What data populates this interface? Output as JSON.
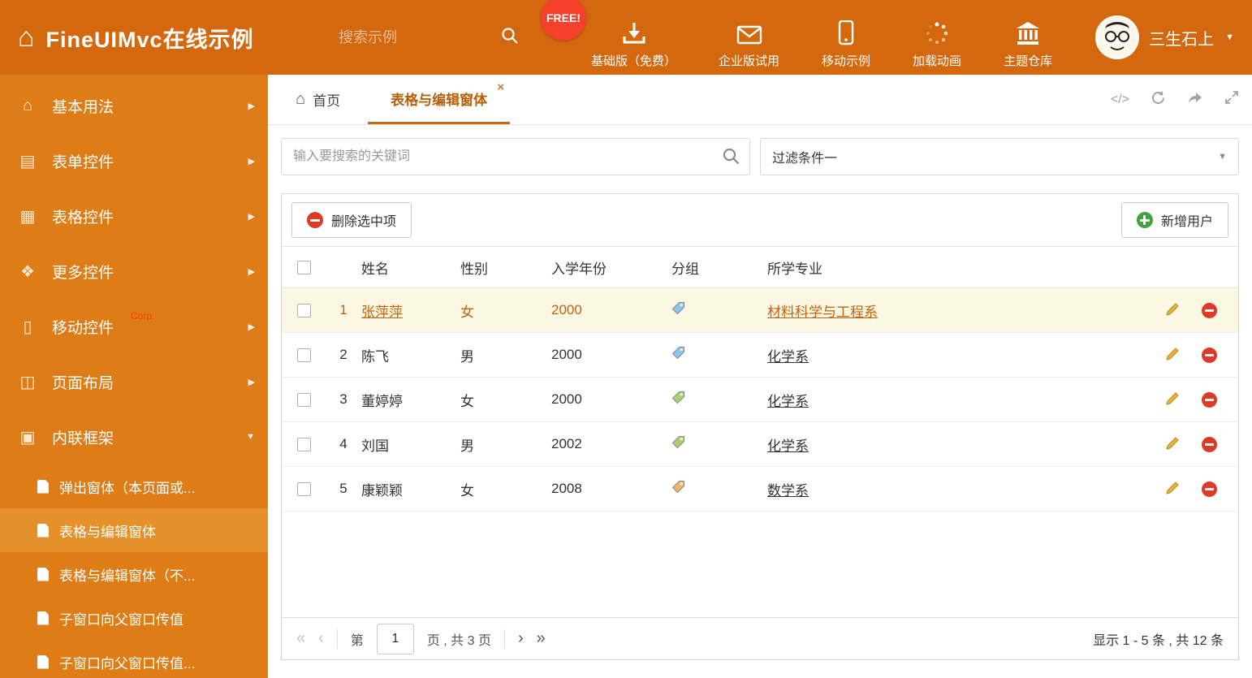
{
  "header": {
    "title": "FineUIMvc在线示例",
    "search_placeholder": "搜索示例",
    "free_badge": "FREE!",
    "nav_items": [
      {
        "label": "基础版（免费）",
        "icon": "download-icon"
      },
      {
        "label": "企业版试用",
        "icon": "mail-icon"
      },
      {
        "label": "移动示例",
        "icon": "mobile-icon"
      },
      {
        "label": "加载动画",
        "icon": "spinner-icon"
      },
      {
        "label": "主题仓库",
        "icon": "bank-icon"
      }
    ],
    "user_name": "三生石上"
  },
  "sidebar": {
    "items": [
      {
        "label": "基本用法"
      },
      {
        "label": "表单控件"
      },
      {
        "label": "表格控件"
      },
      {
        "label": "更多控件"
      },
      {
        "label": "移动控件",
        "badge": "Corp."
      },
      {
        "label": "页面布局"
      },
      {
        "label": "内联框架"
      }
    ],
    "subitems": [
      {
        "label": "弹出窗体（本页面或..."
      },
      {
        "label": "表格与编辑窗体"
      },
      {
        "label": "表格与编辑窗体（不..."
      },
      {
        "label": "子窗口向父窗口传值"
      },
      {
        "label": "子窗口向父窗口传值..."
      }
    ]
  },
  "tabs": {
    "home": "首页",
    "active": "表格与编辑窗体"
  },
  "filters": {
    "search_placeholder": "输入要搜索的关键词",
    "selected_filter": "过滤条件一"
  },
  "toolbar": {
    "delete_label": "删除选中项",
    "add_label": "新增用户"
  },
  "table": {
    "columns": {
      "name": "姓名",
      "gender": "性别",
      "year": "入学年份",
      "group": "分组",
      "major": "所学专业"
    },
    "rows": [
      {
        "num": "1",
        "name": "张萍萍",
        "gender": "女",
        "year": "2000",
        "tag_color": "#8ec6ea",
        "major": "材料科学与工程系",
        "highlighted": true
      },
      {
        "num": "2",
        "name": "陈飞",
        "gender": "男",
        "year": "2000",
        "tag_color": "#8ec6ea",
        "major": "化学系",
        "highlighted": false
      },
      {
        "num": "3",
        "name": "董婷婷",
        "gender": "女",
        "year": "2000",
        "tag_color": "#a8d36c",
        "major": "化学系",
        "highlighted": false
      },
      {
        "num": "4",
        "name": "刘国",
        "gender": "男",
        "year": "2002",
        "tag_color": "#a8d36c",
        "major": "化学系",
        "highlighted": false
      },
      {
        "num": "5",
        "name": "康颖颖",
        "gender": "女",
        "year": "2008",
        "tag_color": "#f3b26a",
        "major": "数学系",
        "highlighted": false
      }
    ]
  },
  "pagination": {
    "page_prefix": "第",
    "current_page": "1",
    "page_suffix": "页 , 共 3 页",
    "summary": "显示 1 - 5 条 , 共 12 条"
  },
  "colors": {
    "accent": "#c2640e",
    "header_bg": "#d4680e",
    "sidebar_bg": "#de7c17",
    "row_highlight": "#fcf7e3",
    "free_badge": "#f5402c"
  }
}
